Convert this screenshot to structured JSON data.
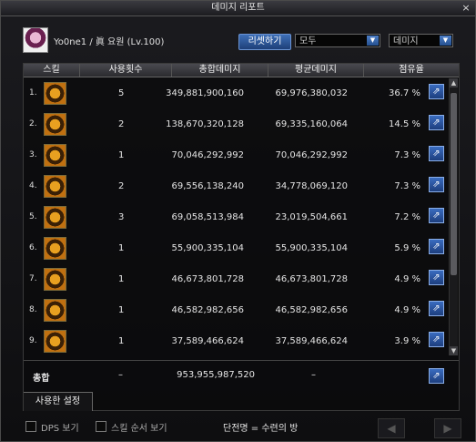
{
  "window": {
    "title": "데미지 리포트",
    "close": "×"
  },
  "player": {
    "name": "Yo0ne1",
    "class_text": "眞 요원 (Lv.100)"
  },
  "controls": {
    "reset_label": "리셋하기",
    "filter_value": "모두",
    "metric_value": "데미지"
  },
  "columns": [
    "스킬",
    "사용횟수",
    "총합데미지",
    "평균데미지",
    "점유율"
  ],
  "rows": [
    {
      "idx": "1.",
      "icon": "skill-slash-icon",
      "count": "5",
      "total": "349,881,900,160",
      "avg": "69,976,380,032",
      "share": "36.7 %"
    },
    {
      "idx": "2.",
      "icon": "skill-emblem-icon",
      "count": "2",
      "total": "138,670,320,128",
      "avg": "69,335,160,064",
      "share": "14.5 %"
    },
    {
      "idx": "3.",
      "icon": "skill-orb-icon",
      "count": "1",
      "total": "70,046,292,992",
      "avg": "70,046,292,992",
      "share": "7.3 %"
    },
    {
      "idx": "4.",
      "icon": "skill-burst-icon",
      "count": "2",
      "total": "69,556,138,240",
      "avg": "34,778,069,120",
      "share": "7.3 %"
    },
    {
      "idx": "5.",
      "icon": "skill-target-icon",
      "count": "3",
      "total": "69,058,513,984",
      "avg": "23,019,504,661",
      "share": "7.2 %"
    },
    {
      "idx": "6.",
      "icon": "skill-runner-icon",
      "count": "1",
      "total": "55,900,335,104",
      "avg": "55,900,335,104",
      "share": "5.9 %"
    },
    {
      "idx": "7.",
      "icon": "skill-swirl-icon",
      "count": "1",
      "total": "46,673,801,728",
      "avg": "46,673,801,728",
      "share": "4.9 %"
    },
    {
      "idx": "8.",
      "icon": "skill-blade-icon",
      "count": "1",
      "total": "46,582,982,656",
      "avg": "46,582,982,656",
      "share": "4.9 %"
    },
    {
      "idx": "9.",
      "icon": "skill-arc-icon",
      "count": "1",
      "total": "37,589,466,624",
      "avg": "37,589,466,624",
      "share": "3.9 %"
    }
  ],
  "totals": {
    "label": "총합",
    "count": "–",
    "total": "953,955,987,520",
    "avg": "–"
  },
  "tab": {
    "label": "사용한 설정"
  },
  "footer": {
    "dps_label": "DPS 보기",
    "order_label": "스킬 순서 보기",
    "dungeon_text": "단전명 = 수련의 방"
  },
  "colors": {
    "accent": "#2f5ea8",
    "icon_gold": "#e8a020",
    "icon_dark": "#3a2006"
  }
}
